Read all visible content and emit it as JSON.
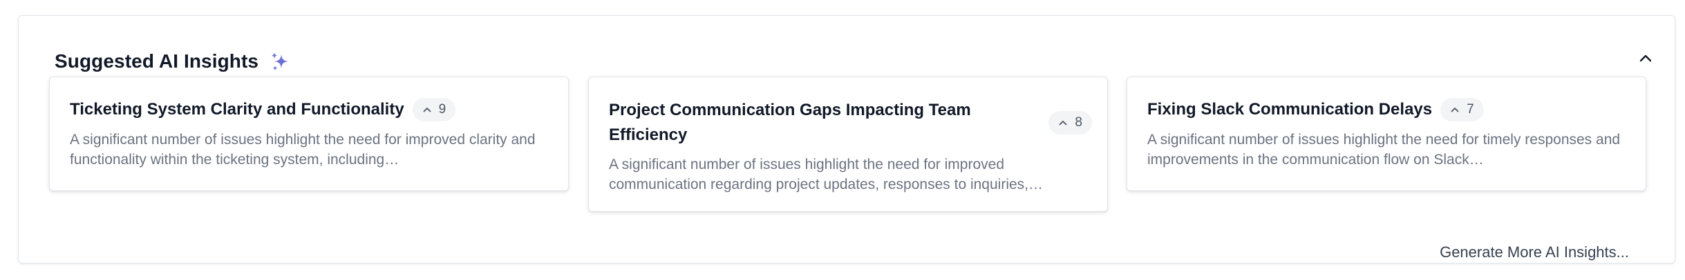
{
  "panel": {
    "title": "Suggested AI Insights",
    "title_icon": "sparkle-icon",
    "collapse_icon": "chevron-up-icon",
    "accent_color": "#6b6fd6"
  },
  "cards": [
    {
      "title": "Ticketing System Clarity and Functionality",
      "count": "9",
      "count_icon": "chevron-up-icon",
      "description": "A significant number of issues highlight the need for improved clarity and functionality within the ticketing system, including…"
    },
    {
      "title": "Project Communication Gaps Impacting Team Efficiency",
      "count": "8",
      "count_icon": "chevron-up-icon",
      "description": "A significant number of issues highlight the need for improved communication regarding project updates, responses to inquiries,…"
    },
    {
      "title": "Fixing Slack Communication Delays",
      "count": "7",
      "count_icon": "chevron-up-icon",
      "description": "A significant number of issues highlight the need for timely responses and improvements in the communication flow on Slack…"
    }
  ],
  "footer": {
    "generate_label": "Generate More AI Insights..."
  }
}
